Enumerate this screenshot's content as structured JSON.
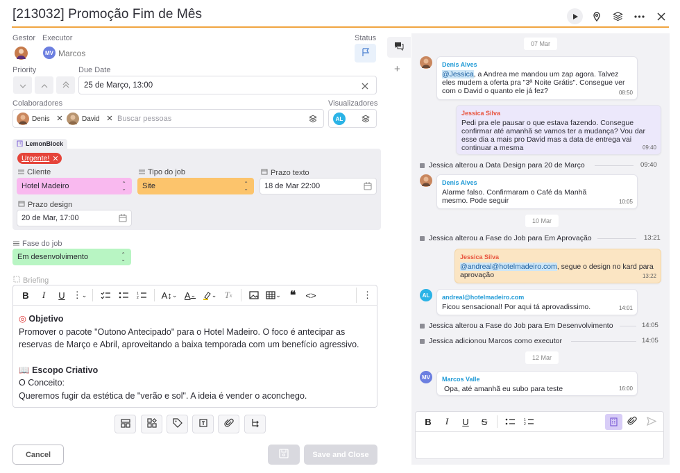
{
  "header": {
    "title": "[213032] Promoção Fim de Mês"
  },
  "assign": {
    "gestor_label": "Gestor",
    "executor_label": "Executor",
    "executor_initials": "MV",
    "executor_name": "Marcos",
    "status_label": "Status"
  },
  "priority": {
    "label": "Priority"
  },
  "due": {
    "label": "Due Date",
    "value": "25 de Março, 13:00"
  },
  "colab": {
    "label": "Colaboradores",
    "people": [
      "Denis",
      "David"
    ],
    "search_placeholder": "Buscar pessoas",
    "viewers_label": "Visualizadores",
    "viewer_initials": "AL"
  },
  "block": {
    "name": "LemonBlock",
    "tag": "Urgente!",
    "cliente_label": "Cliente",
    "cliente_value": "Hotel Madeiro",
    "tipo_label": "Tipo do job",
    "tipo_value": "Site",
    "prazo_texto_label": "Prazo texto",
    "prazo_texto_value": "18 de Mar 22:00",
    "prazo_design_label": "Prazo design",
    "prazo_design_value": "20 de Mar, 17:00"
  },
  "fase": {
    "label": "Fase do job",
    "value": "Em desenvolvimento"
  },
  "briefing": {
    "label": "Briefing",
    "h1": "Objetivo",
    "p1": "Promover o pacote \"Outono Antecipado\" para o Hotel Madeiro. O foco é antecipar as reservas de Março e Abril, aproveitando a baixa temporada com um benefício agressivo.",
    "h2": "Escopo Criativo",
    "p2": "O Conceito:",
    "p3": "Queremos fugir da estética de \"verão e sol\". A ideia é vender o aconchego."
  },
  "footer": {
    "cancel": "Cancel",
    "save_close": "Save and Close"
  },
  "colors": {
    "accent": "#f0a541",
    "urgent": "#e5443a",
    "cliente_bg": "#f9b9ef",
    "tipo_bg": "#fcc46c",
    "fase_bg": "#b8f5c3"
  },
  "chat": {
    "d1": "07 Mar",
    "m1": {
      "name": "Denis Alves",
      "mention": "@Jessica",
      "text": ", a Andrea me mandou um zap agora. Talvez eles mudem a oferta pra \"3ª Noite Grátis\". Consegue ver com o David o quanto ele já fez?",
      "time": "08:50"
    },
    "m2": {
      "name": "Jessica Silva",
      "text": "Pedi pra ele pausar o que estava fazendo. Consegue confirmar até amanhã se vamos ter a mudança? Vou dar esse dia a mais pro David mas a data de entrega vai continuar a mesma",
      "time": "09:40"
    },
    "s1": {
      "text": "Jessica alterou a Data Design para 20 de Março",
      "time": "09:40"
    },
    "m3": {
      "name": "Denis Alves",
      "text": "Alarme falso. Confirmaram o Café da Manhã mesmo. Pode seguir",
      "time": "10:05"
    },
    "d2": "10 Mar",
    "s2": {
      "text": "Jessica alterou a Fase do Job para Em Aprovação",
      "time": "13:21"
    },
    "m4": {
      "name": "Jessica Silva",
      "mention": "@andreal@hotelmadeiro.com",
      "text": ", segue o design no kard para aprovação",
      "time": "13:22"
    },
    "m5": {
      "name": "andreal@hotelmadeiro.com",
      "initials": "AL",
      "text": "Ficou sensacional! Por aqui tá aprovadissimo.",
      "time": "14:01"
    },
    "s3": {
      "text": "Jessica alterou a Fase do Job para Em Desenvolvimento",
      "time": "14:05"
    },
    "s4": {
      "text": "Jessica adicionou Marcos como executor",
      "time": "14:05"
    },
    "d3": "12 Mar",
    "m6": {
      "name": "Marcos Valle",
      "initials": "MV",
      "text": "Opa, até amanhã eu subo para teste",
      "time": "16:00"
    }
  }
}
